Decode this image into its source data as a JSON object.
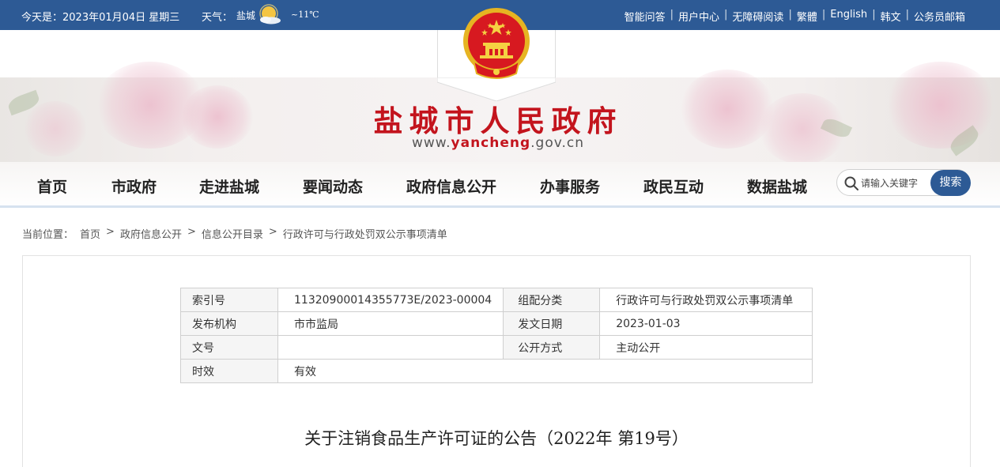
{
  "topbar": {
    "date": "今天是：2023年01月04日 星期三",
    "weather_label": "天气：",
    "city": "盐城",
    "weather_icon": "sun-cloud-icon",
    "temperature": "~11℃",
    "links": [
      "智能问答",
      "用户中心",
      "无障碍阅读",
      "繁體",
      "English",
      "韩文",
      "公务员邮箱"
    ]
  },
  "header": {
    "title": "盐城市人民政府",
    "url_prefix": "www.",
    "url_domain": "yancheng",
    "url_suffix": ".gov.cn"
  },
  "nav": {
    "items": [
      "首页",
      "市政府",
      "走进盐城",
      "要闻动态",
      "政府信息公开",
      "办事服务",
      "政民互动",
      "数据盐城"
    ]
  },
  "search": {
    "placeholder": "请输入关键字",
    "button": "搜索"
  },
  "breadcrumb": {
    "label": "当前位置：",
    "items": [
      "首页",
      "政府信息公开",
      "信息公开目录",
      "行政许可与行政处罚双公示事项清单"
    ]
  },
  "meta": {
    "index_label": "索引号",
    "index_value": "11320900014355773E/2023-00004",
    "category_label": "组配分类",
    "category_value": "行政许可与行政处罚双公示事项清单",
    "publisher_label": "发布机构",
    "publisher_value": "市市监局",
    "date_label": "发文日期",
    "date_value": "2023-01-03",
    "docno_label": "文号",
    "docno_value": "",
    "disclosure_label": "公开方式",
    "disclosure_value": "主动公开",
    "validity_label": "时效",
    "validity_value": "有效"
  },
  "article": {
    "title": "关于注销食品生产许可证的公告（2022年 第19号）"
  },
  "colors": {
    "topbar": "#2d5a95",
    "title_red": "#c3141d",
    "search_button": "#2d5a95"
  }
}
